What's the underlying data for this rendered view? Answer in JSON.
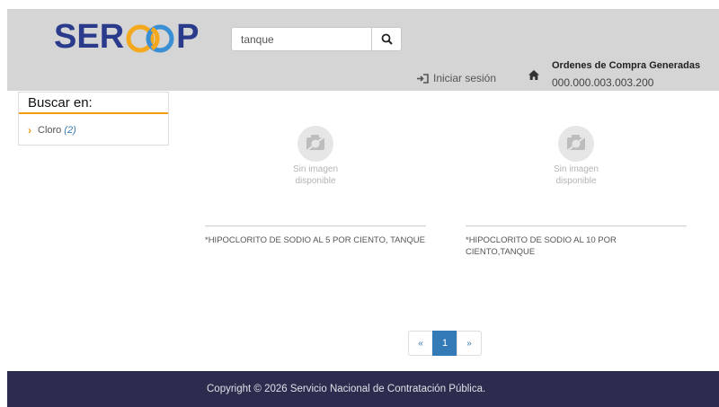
{
  "header": {
    "logo": {
      "prefix": "SER",
      "suffix": "P"
    },
    "search": {
      "value": "tanque",
      "icon": "search-icon"
    },
    "login_label": "Iniciar sesión",
    "orders_title": "Ordenes de Compra Generadas",
    "orders_number": "000.000.003.003.200"
  },
  "sidebar": {
    "title": "Buscar en:",
    "items": [
      {
        "label": "Cloro",
        "count": "(2)"
      }
    ]
  },
  "products": [
    {
      "image_text_1": "Sin imagen",
      "image_text_2": "disponible",
      "name": "*HIPOCLORITO DE SODIO AL 5 POR CIENTO, TANQUE"
    },
    {
      "image_text_1": "Sin imagen",
      "image_text_2": "disponible",
      "name": "*HIPOCLORITO DE SODIO AL 10 POR CIENTO,TANQUE"
    }
  ],
  "pagination": {
    "prev": "«",
    "current": "1",
    "next": "»"
  },
  "footer": {
    "copyright": "Copyright © 2026 Servicio Nacional de Contratación Pública."
  },
  "colors": {
    "brand_blue": "#2b3b8c",
    "accent_orange": "#f39c12",
    "footer_bg": "#2c2c4f",
    "link_blue": "#337ab7"
  }
}
